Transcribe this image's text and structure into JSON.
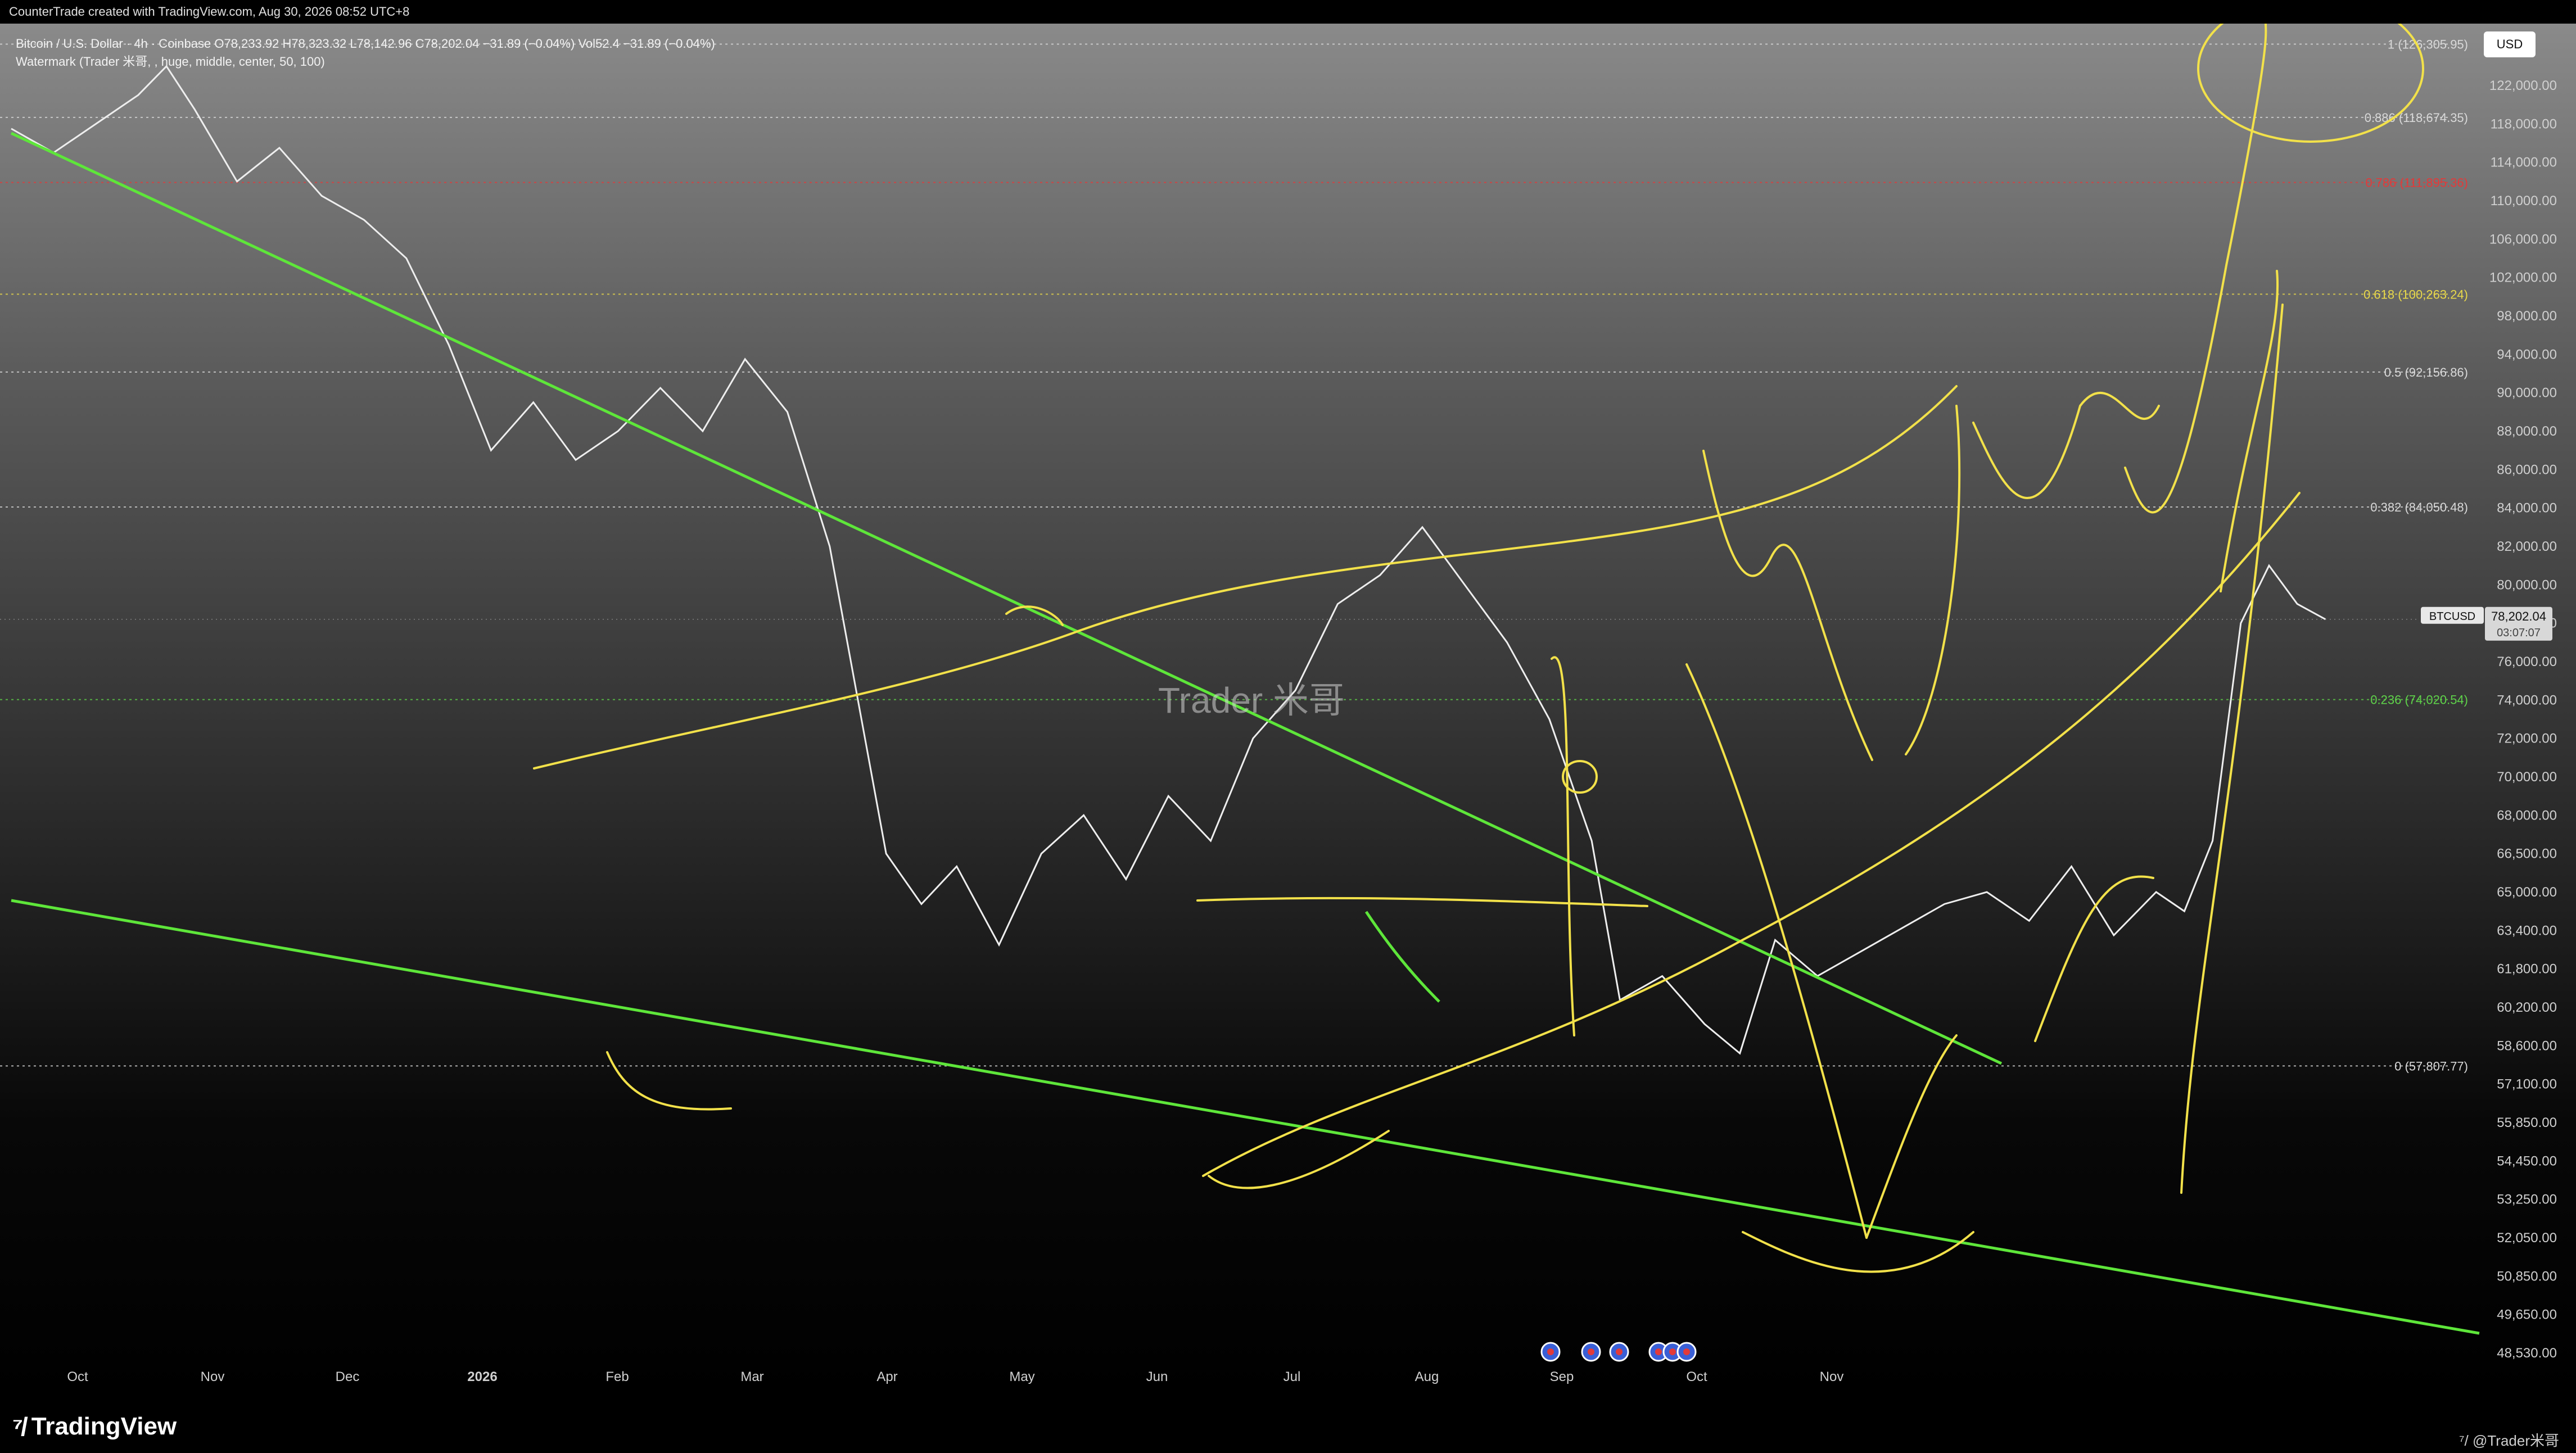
{
  "header": {
    "credit": "CounterTrade created with TradingView.com, Aug 30, 2026 08:52 UTC+8",
    "legend_line1": "Bitcoin / U.S. Dollar · 4h · Coinbase  O78,233.92  H78,323.32  L78,142.96  C78,202.04  −31.89 (−0.04%)  Vol52.4  −31.89 (−0.04%)",
    "legend_line2": "Watermark (Trader 米哥, , huge, middle, center, 50, 100)",
    "currency": "USD"
  },
  "watermark_text": "Trader 米哥",
  "footer": {
    "brand": "TradingView",
    "author": "@Trader米哥"
  },
  "chart_data": {
    "type": "line",
    "symbol": "BTCUSD",
    "last_price": "78,202.04",
    "countdown": "03:07:07",
    "x_labels": [
      "Oct",
      "Nov",
      "Dec",
      "2026",
      "Feb",
      "Mar",
      "Apr",
      "May",
      "Jun",
      "Jul",
      "Aug",
      "Sep",
      "Oct",
      "Nov"
    ],
    "y_ticks": [
      "122,000.00",
      "118,000.00",
      "114,000.00",
      "110,000.00",
      "106,000.00",
      "102,000.00",
      "98,000.00",
      "94,000.00",
      "90,000.00",
      "88,000.00",
      "86,000.00",
      "84,000.00",
      "82,000.00",
      "80,000.00",
      "78,000.00",
      "76,000.00",
      "74,000.00",
      "72,000.00",
      "70,000.00",
      "68,000.00",
      "66,500.00",
      "65,000.00",
      "63,400.00",
      "61,800.00",
      "60,200.00",
      "58,600.00",
      "57,100.00",
      "55,850.00",
      "54,450.00",
      "53,250.00",
      "52,050.00",
      "50,850.00",
      "49,650.00",
      "48,530.00"
    ],
    "fib_levels": [
      {
        "label": "1 (126,305.95)",
        "color": "#d9d9d9"
      },
      {
        "label": "0.886 (118,674.35)",
        "color": "#d9d9d9"
      },
      {
        "label": "0.786 (111,895.36)",
        "color": "#e23a3a"
      },
      {
        "label": "0.618 (100,263.24)",
        "color": "#e8d84a"
      },
      {
        "label": "0.5 (92,156.86)",
        "color": "#d9d9d9"
      },
      {
        "label": "0.382 (84,050.48)",
        "color": "#d9d9d9"
      },
      {
        "label": "0.236 (74,020.54)",
        "color": "#5fd34a"
      },
      {
        "label": "0 (57,807.77)",
        "color": "#d9d9d9"
      }
    ],
    "price_series": {
      "name": "",
      "points": [
        [
          0.0,
          117500
        ],
        [
          0.3,
          115000
        ],
        [
          0.6,
          118000
        ],
        [
          0.9,
          121000
        ],
        [
          1.1,
          124000
        ],
        [
          1.3,
          119500
        ],
        [
          1.6,
          112000
        ],
        [
          1.9,
          115500
        ],
        [
          2.2,
          110500
        ],
        [
          2.5,
          108000
        ],
        [
          2.8,
          104000
        ],
        [
          3.1,
          95000
        ],
        [
          3.4,
          87000
        ],
        [
          3.7,
          89500
        ],
        [
          4.0,
          86500
        ],
        [
          4.3,
          88000
        ],
        [
          4.6,
          90500
        ],
        [
          4.9,
          88000
        ],
        [
          5.2,
          93500
        ],
        [
          5.5,
          89000
        ],
        [
          5.8,
          82000
        ],
        [
          6.0,
          74000
        ],
        [
          6.2,
          66500
        ],
        [
          6.45,
          64500
        ],
        [
          6.7,
          66000
        ],
        [
          7.0,
          62800
        ],
        [
          7.3,
          66500
        ],
        [
          7.6,
          68000
        ],
        [
          7.9,
          65500
        ],
        [
          8.2,
          69000
        ],
        [
          8.5,
          67000
        ],
        [
          8.8,
          72000
        ],
        [
          9.1,
          74500
        ],
        [
          9.4,
          79000
        ],
        [
          9.7,
          80500
        ],
        [
          10.0,
          83000
        ],
        [
          10.3,
          80000
        ],
        [
          10.6,
          77000
        ],
        [
          10.9,
          73000
        ],
        [
          11.2,
          67000
        ],
        [
          11.4,
          60500
        ],
        [
          11.7,
          61500
        ],
        [
          12.0,
          59500
        ],
        [
          12.25,
          58300
        ],
        [
          12.5,
          63000
        ],
        [
          12.8,
          61500
        ],
        [
          13.1,
          62500
        ],
        [
          13.4,
          63500
        ],
        [
          13.7,
          64500
        ],
        [
          14.0,
          65000
        ],
        [
          14.3,
          63800
        ],
        [
          14.6,
          66000
        ],
        [
          14.9,
          63200
        ],
        [
          15.2,
          65000
        ],
        [
          15.4,
          64200
        ],
        [
          15.6,
          67000
        ],
        [
          15.8,
          78000
        ],
        [
          16.0,
          81000
        ],
        [
          16.2,
          79000
        ],
        [
          16.4,
          78200
        ]
      ]
    }
  }
}
